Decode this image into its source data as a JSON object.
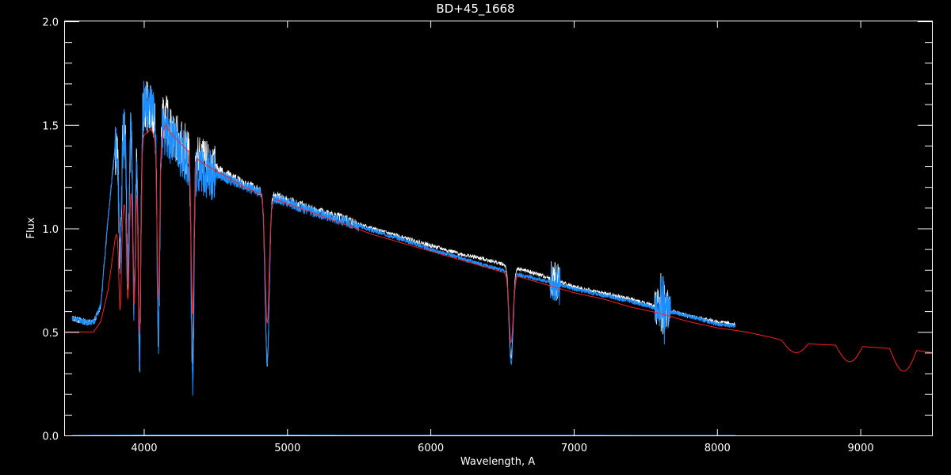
{
  "chart_data": {
    "type": "line",
    "title": "BD+45_1668",
    "xlabel": "Wavelength, A",
    "ylabel": "Flux",
    "xlim": [
      3450,
      9500
    ],
    "ylim": [
      0.0,
      2.0
    ],
    "xticks": [
      4000,
      5000,
      6000,
      7000,
      8000,
      9000
    ],
    "xtick_labels": [
      "4000",
      "5000",
      "6000",
      "7000",
      "8000",
      "9000"
    ],
    "yticks": [
      0.0,
      0.5,
      1.0,
      1.5,
      2.0
    ],
    "ytick_labels": [
      "0.0",
      "0.5",
      "1.0",
      "1.5",
      "2.0"
    ],
    "background": "#000000",
    "grid": false,
    "series": [
      {
        "color": "#ffffff",
        "x": [
          3500,
          3550,
          3600,
          3650,
          3700,
          3750,
          3800,
          3850,
          3900,
          3950,
          4000,
          4050,
          4100,
          4150,
          4200,
          4300,
          4400,
          4500,
          4600,
          4700,
          4800,
          5000,
          5200,
          5400,
          5600,
          5800,
          6000,
          6200,
          6400,
          6600,
          6800,
          7000,
          7200,
          7400,
          7600,
          7800,
          8000,
          8130
        ],
        "y": [
          0.57,
          0.56,
          0.55,
          0.55,
          0.63,
          1.05,
          1.4,
          1.5,
          1.55,
          1.58,
          1.62,
          1.6,
          1.5,
          1.56,
          1.48,
          1.4,
          1.34,
          1.3,
          1.26,
          1.22,
          1.19,
          1.14,
          1.09,
          1.05,
          1.0,
          0.96,
          0.92,
          0.88,
          0.85,
          0.81,
          0.77,
          0.72,
          0.69,
          0.66,
          0.62,
          0.58,
          0.55,
          0.54
        ]
      },
      {
        "color": "#1e8fff",
        "x": [
          3500,
          3550,
          3600,
          3650,
          3700,
          3750,
          3800,
          3850,
          3900,
          3950,
          4000,
          4050,
          4100,
          4150,
          4200,
          4300,
          4400,
          4500,
          4600,
          4700,
          4800,
          5000,
          5200,
          5400,
          5600,
          5800,
          6000,
          6200,
          6400,
          6600,
          6800,
          7000,
          7200,
          7400,
          7600,
          7800,
          8000,
          8130
        ],
        "y": [
          0.57,
          0.56,
          0.55,
          0.55,
          0.63,
          1.05,
          1.4,
          1.5,
          1.55,
          1.58,
          1.62,
          1.6,
          1.5,
          1.5,
          1.44,
          1.36,
          1.31,
          1.27,
          1.24,
          1.21,
          1.18,
          1.13,
          1.08,
          1.04,
          0.99,
          0.95,
          0.9,
          0.86,
          0.82,
          0.78,
          0.75,
          0.71,
          0.68,
          0.65,
          0.61,
          0.58,
          0.54,
          0.53
        ]
      },
      {
        "color": "#ff1e1e",
        "x": [
          3450,
          3550,
          3650,
          3700,
          3750,
          3800,
          3850,
          3900,
          3950,
          4000,
          4050,
          4100,
          4150,
          4200,
          4300,
          4400,
          4500,
          4600,
          4700,
          4800,
          5000,
          5200,
          5400,
          5600,
          5800,
          6000,
          6200,
          6400,
          6600,
          6800,
          7000,
          7200,
          7400,
          7600,
          7800,
          8000,
          8200,
          8400,
          8500,
          8700,
          9000,
          9200,
          9400,
          9500
        ],
        "y": [
          0.5,
          0.5,
          0.5,
          0.55,
          0.7,
          0.95,
          1.1,
          1.2,
          1.35,
          1.45,
          1.48,
          1.4,
          1.5,
          1.45,
          1.38,
          1.32,
          1.28,
          1.24,
          1.2,
          1.17,
          1.12,
          1.07,
          1.02,
          0.97,
          0.93,
          0.89,
          0.85,
          0.81,
          0.77,
          0.73,
          0.69,
          0.66,
          0.62,
          0.59,
          0.55,
          0.52,
          0.5,
          0.47,
          0.45,
          0.44,
          0.43,
          0.42,
          0.41,
          0.4
        ]
      },
      {
        "color": "#1e8fff",
        "x": [
          3500,
          4000,
          4500,
          5000,
          5500,
          6000,
          6500,
          7000,
          7500,
          8000,
          8130
        ],
        "y": [
          0.0,
          0.002,
          0.002,
          0.002,
          0.001,
          0.001,
          0.001,
          0.001,
          0.0,
          0.0,
          0.0
        ]
      }
    ],
    "absorption_lines": [
      {
        "x": 3835,
        "depth": 0.6
      },
      {
        "x": 3889,
        "depth": 0.7
      },
      {
        "x": 3933,
        "depth": 0.9
      },
      {
        "x": 3970,
        "depth": 1.2
      },
      {
        "x": 4102,
        "depth": 1.0
      },
      {
        "x": 4340,
        "depth": 1.05
      },
      {
        "x": 4861,
        "depth": 0.82
      },
      {
        "x": 6563,
        "depth": 0.44
      }
    ],
    "telluric_features": [
      {
        "x": 6870
      },
      {
        "x": 7600
      },
      {
        "x": 7640
      }
    ]
  }
}
